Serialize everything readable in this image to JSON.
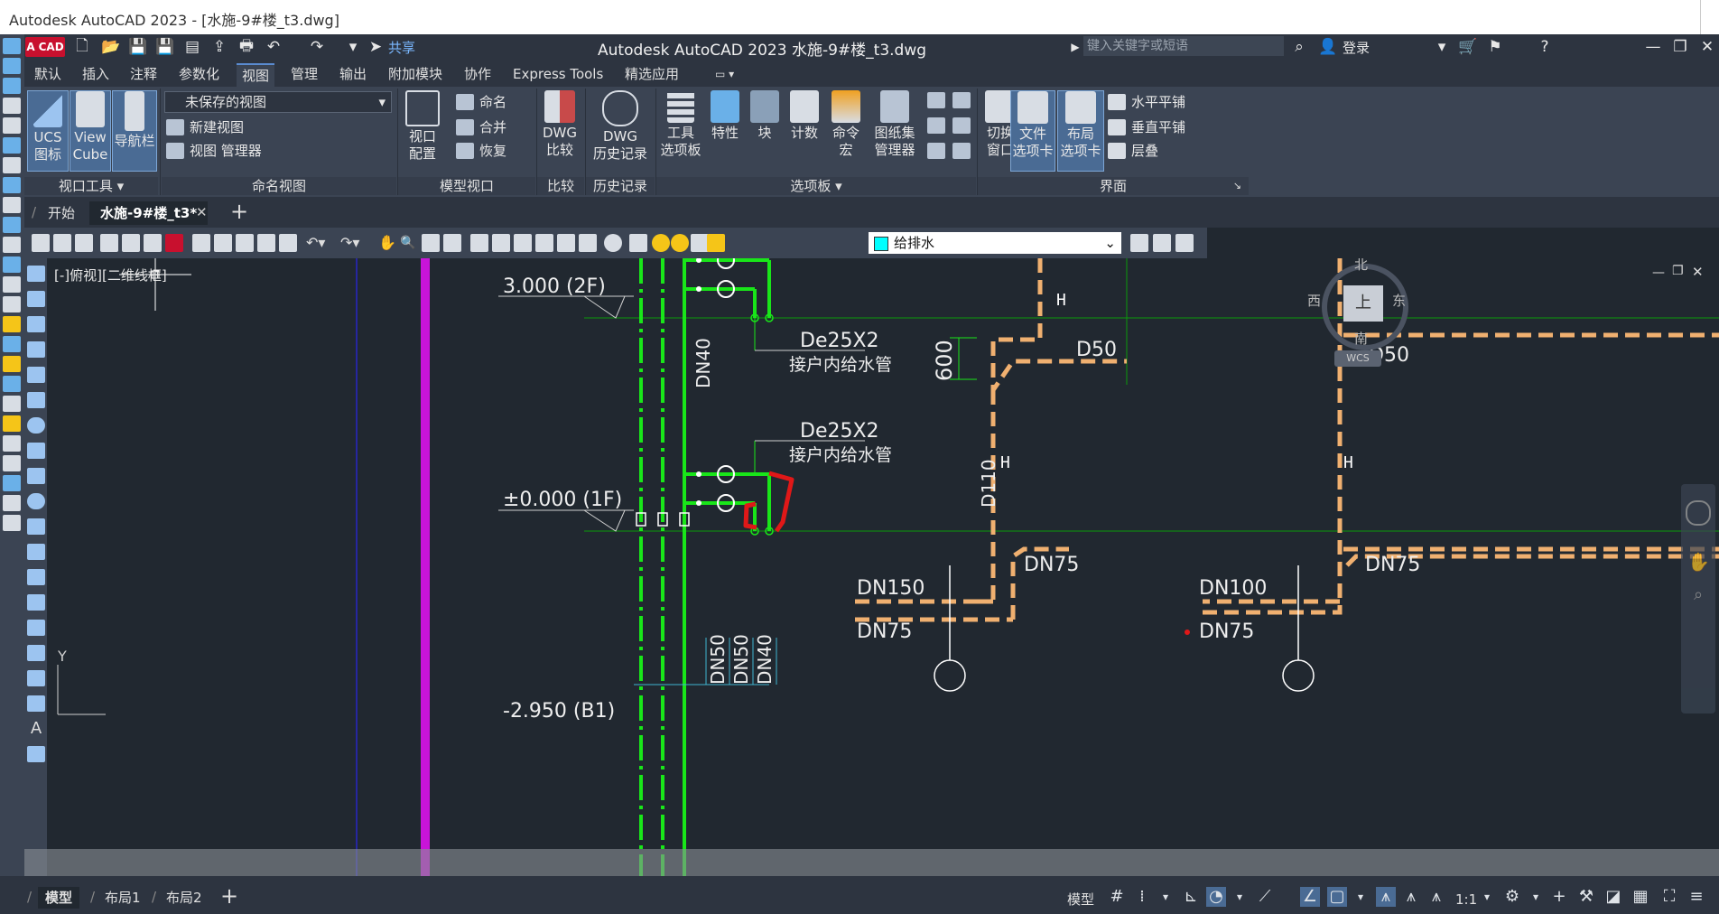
{
  "window": {
    "title": "Autodesk AutoCAD 2023 - [水施-9#楼_t3.dwg]"
  },
  "app": {
    "brand_a": "A",
    "brand_cad": "CAD",
    "share": "共享",
    "title": "Autodesk AutoCAD 2023   水施-9#楼_t3.dwg",
    "search_placeholder": "键入关键字或短语",
    "login": "登录"
  },
  "ribbon_tabs": [
    "默认",
    "插入",
    "注释",
    "参数化",
    "视图",
    "管理",
    "输出",
    "附加模块",
    "协作",
    "Express Tools",
    "精选应用"
  ],
  "ribbon_active": "视图",
  "ribbon": {
    "viewport_tools": {
      "ucs": "UCS\n图标",
      "viewcube": "View\nCube",
      "navbar": "导航栏",
      "footer": "视口工具"
    },
    "named_views": {
      "dropdown": "未保存的视图",
      "new_view": "新建视图",
      "view_manager": "视图 管理器",
      "footer": "命名视图"
    },
    "model_viewports": {
      "config": "视口\n配置",
      "name": "命名",
      "join": "合并",
      "restore": "恢复",
      "footer": "模型视口"
    },
    "compare": {
      "dwg_compare": "DWG\n比较",
      "footer": "比较"
    },
    "history": {
      "dwg_history": "DWG\n历史记录",
      "footer": "历史记录"
    },
    "palettes": {
      "tool_palettes": "工具\n选项板",
      "properties": "特性",
      "block": "块",
      "calculator": "计数",
      "command": "命令\n宏",
      "sheetset": "图纸集\n管理器",
      "footer": "选项板"
    },
    "interface": {
      "switch_window": "切换\n窗口",
      "file_tabs": "文件\n选项卡",
      "layout_tabs": "布局\n选项卡",
      "tile_h": "水平平铺",
      "tile_v": "垂直平铺",
      "cascade": "层叠",
      "footer": "界面"
    }
  },
  "doc_tabs": {
    "start": "开始",
    "active": "水施-9#楼_t3*"
  },
  "toolbar": {
    "layer": "给排水",
    "layer_color": "#00ffff"
  },
  "viewport": {
    "label": "[-]俯视][二维线框]"
  },
  "viewcube": {
    "north": "北",
    "south": "南",
    "east": "东",
    "west": "西",
    "top": "上",
    "wcs": "WCS"
  },
  "drawing": {
    "level_2f": "3.000 (2F)",
    "level_1f": "±0.000 (1F)",
    "level_b1": "-2.950 (B1)",
    "pipe_de25_a": "De25X2",
    "pipe_de25_b": "De25X2",
    "pipe_desc_a": "接户内给水管",
    "pipe_desc_b": "接户内给水管",
    "dn40_v": "DN40",
    "dn50_v1": "DN50",
    "dn50_v2": "DN50",
    "dn40_v2": "DN40",
    "d50_a": "D50",
    "d50_b": "D50",
    "d110": "D110",
    "dim_600": "600",
    "dn150": "DN150",
    "dn75_a": "DN75",
    "dn75_b": "DN75",
    "dn100": "DN100",
    "dn75_c": "DN75",
    "dn75_d": "DN75",
    "axis_y": "Y"
  },
  "status": {
    "model_tab": "模型",
    "layout1": "布局1",
    "layout2": "布局2",
    "model_btn": "模型",
    "scale": "1:1"
  }
}
